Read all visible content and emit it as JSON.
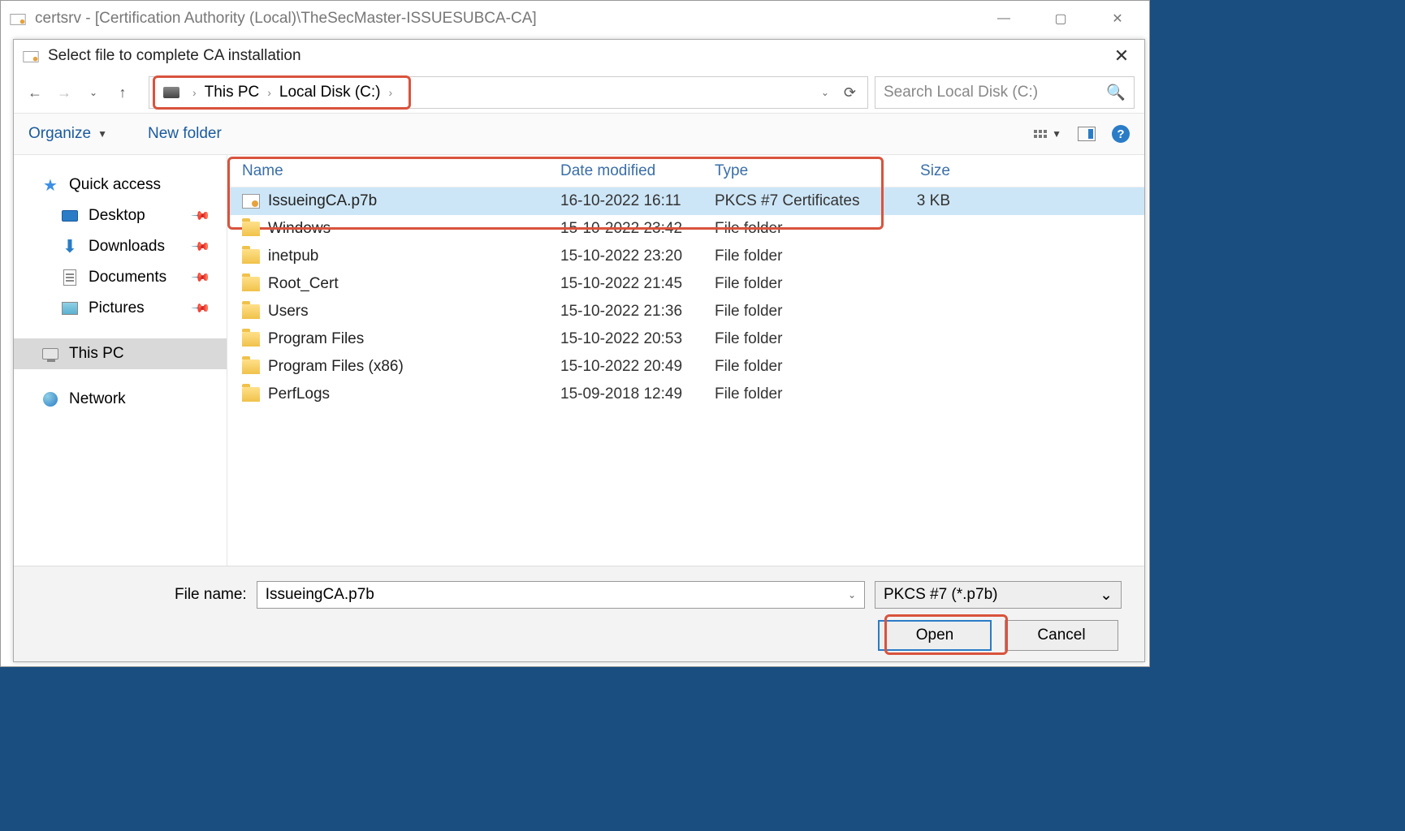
{
  "outer_window": {
    "title": "certsrv - [Certification Authority (Local)\\TheSecMaster-ISSUESUBCA-CA]"
  },
  "dialog": {
    "title": "Select file to complete CA installation"
  },
  "breadcrumb": {
    "root": "This PC",
    "current": "Local Disk (C:)"
  },
  "search": {
    "placeholder": "Search Local Disk (C:)"
  },
  "toolbar": {
    "organize": "Organize",
    "new_folder": "New folder"
  },
  "sidebar": {
    "quick_access": "Quick access",
    "desktop": "Desktop",
    "downloads": "Downloads",
    "documents": "Documents",
    "pictures": "Pictures",
    "this_pc": "This PC",
    "network": "Network"
  },
  "columns": {
    "name": "Name",
    "date": "Date modified",
    "type": "Type",
    "size": "Size"
  },
  "files": [
    {
      "name": "IssueingCA.p7b",
      "date": "16-10-2022 16:11",
      "type": "PKCS #7 Certificates",
      "size": "3 KB",
      "icon": "cert",
      "selected": true
    },
    {
      "name": "Windows",
      "date": "15-10-2022 23:42",
      "type": "File folder",
      "size": "",
      "icon": "folder"
    },
    {
      "name": "inetpub",
      "date": "15-10-2022 23:20",
      "type": "File folder",
      "size": "",
      "icon": "folder"
    },
    {
      "name": "Root_Cert",
      "date": "15-10-2022 21:45",
      "type": "File folder",
      "size": "",
      "icon": "folder"
    },
    {
      "name": "Users",
      "date": "15-10-2022 21:36",
      "type": "File folder",
      "size": "",
      "icon": "folder"
    },
    {
      "name": "Program Files",
      "date": "15-10-2022 20:53",
      "type": "File folder",
      "size": "",
      "icon": "folder"
    },
    {
      "name": "Program Files (x86)",
      "date": "15-10-2022 20:49",
      "type": "File folder",
      "size": "",
      "icon": "folder"
    },
    {
      "name": "PerfLogs",
      "date": "15-09-2018 12:49",
      "type": "File folder",
      "size": "",
      "icon": "folder"
    }
  ],
  "footer": {
    "file_name_label": "File name:",
    "file_name_value": "IssueingCA.p7b",
    "filter": "PKCS #7 (*.p7b)",
    "open": "Open",
    "cancel": "Cancel"
  }
}
